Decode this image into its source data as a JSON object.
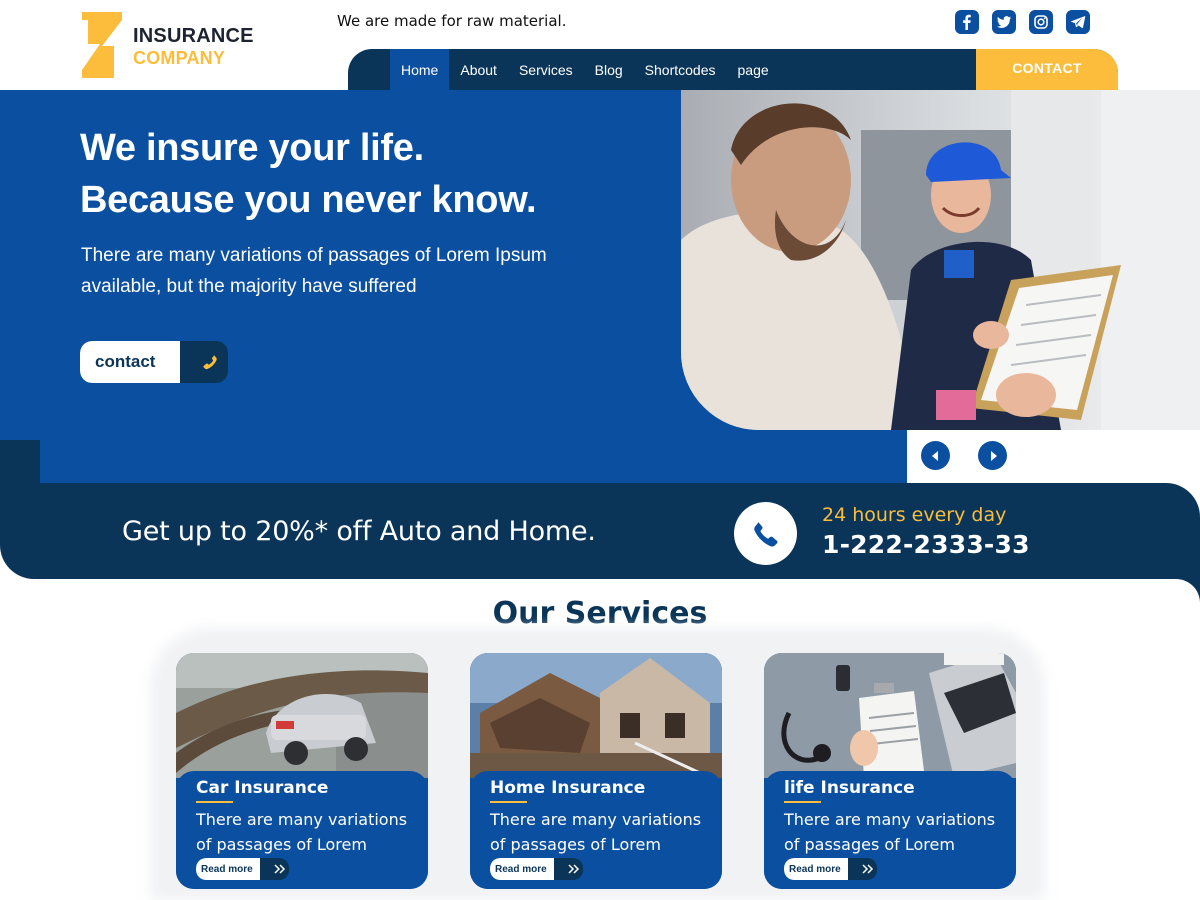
{
  "brand": {
    "name_line1": "INSURANCE",
    "name_line2": "COMPANY",
    "colors": {
      "primary": "#0b4fa0",
      "dark": "#0a3558",
      "accent": "#fbbd3b"
    }
  },
  "header": {
    "tagline": "We are made for raw material.",
    "socials": [
      {
        "icon": "facebook-icon"
      },
      {
        "icon": "twitter-icon"
      },
      {
        "icon": "instagram-icon"
      },
      {
        "icon": "telegram-icon"
      }
    ]
  },
  "nav": {
    "items": [
      {
        "label": "Home",
        "active": true
      },
      {
        "label": "About"
      },
      {
        "label": "Services"
      },
      {
        "label": "Blog"
      },
      {
        "label": "Shortcodes"
      },
      {
        "label": "page"
      }
    ],
    "contact_label": "CONTACT"
  },
  "hero": {
    "title_line1": "We insure your life.",
    "title_line2": "Because you never know.",
    "subtitle": "There are many variations of passages of Lorem Ipsum available, but the majority have suffered",
    "cta_label": "contact",
    "cta_icon": "phone-icon",
    "photo": "delivery-person-with-clipboard-photo",
    "prev_icon": "arrow-left-icon",
    "next_icon": "arrow-right-icon"
  },
  "promo": {
    "text": "Get up to 20%* off Auto and Home.",
    "hours": "24 hours every day",
    "phone": "1-222-2333-33",
    "icon": "phone-icon"
  },
  "services": {
    "title": "Our Services",
    "cards": [
      {
        "title": "Car Insurance",
        "text": "There are many variations of passages of Lorem",
        "read_more": "Read more",
        "image": "damaged-car-photo"
      },
      {
        "title": "Home Insurance",
        "text": "There are many variations of passages of Lorem",
        "read_more": "Read more",
        "image": "damaged-house-photo"
      },
      {
        "title": "life Insurance",
        "text": "There are many variations of passages of Lorem",
        "read_more": "Read more",
        "image": "medical-form-photo"
      }
    ]
  }
}
